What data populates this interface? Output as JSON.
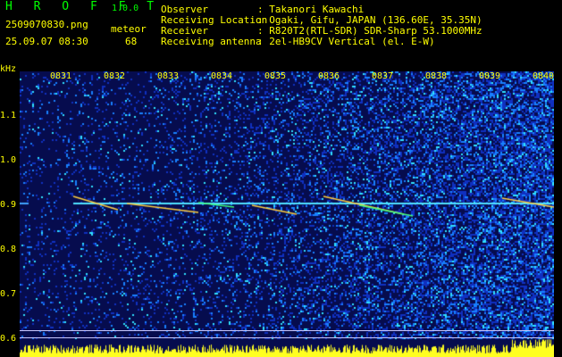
{
  "app": {
    "title": "H R O F F T",
    "version": "1.0.0",
    "filename": "2509070830.png",
    "datetime": "25.09.07 08:30",
    "meteor_label": "meteor",
    "meteor_count": "68"
  },
  "info": [
    {
      "label": "Observer",
      "value": ": Takanori Kawachi"
    },
    {
      "label": "Receiving Location",
      "value": ": Ogaki, Gifu, JAPAN (136.60E, 35.35N)"
    },
    {
      "label": "Receiver",
      "value": ": R820T2(RTL-SDR) SDR-Sharp 53.1000MHz"
    },
    {
      "label": "Receiving antenna",
      "value": ": 2el-HB9CV Vertical (el. E-W)"
    }
  ],
  "axis": {
    "y_unit": "kHz",
    "x_ticks": [
      "0831",
      "0832",
      "0833",
      "0834",
      "0835",
      "0836",
      "0837",
      "0838",
      "0839",
      "0840"
    ],
    "y_ticks": [
      "1.1",
      "1.0",
      "0.9",
      "0.8",
      "0.7",
      "0.6"
    ]
  },
  "colors": {
    "background": "#000000",
    "spectrogram_base": "#060c4e",
    "label_yellow": "#ffff00",
    "title_green": "#00ff00"
  }
}
